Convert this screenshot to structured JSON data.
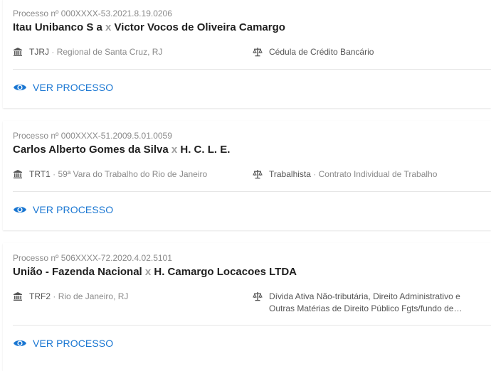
{
  "results": [
    {
      "process_prefix": "Processo nº",
      "process_number": "000XXXX-53.2021.8.19.0206",
      "party_a": "Itau Unibanco S a",
      "separator": "x",
      "party_b": "Victor Vocos de Oliveira Camargo",
      "court": "TJRJ",
      "court_detail": "Regional de Santa Cruz, RJ",
      "subject_main": "Cédula de Crédito Bancário",
      "subject_detail": "",
      "action_label": "VER PROCESSO",
      "court_icon": "bank-icon",
      "subject_icon": "scales-icon",
      "action_icon": "eye-icon"
    },
    {
      "process_prefix": "Processo nº",
      "process_number": "000XXXX-51.2009.5.01.0059",
      "party_a": "Carlos Alberto Gomes da Silva",
      "separator": "x",
      "party_b": "H. C. L. E.",
      "court": "TRT1",
      "court_detail": "59ª Vara do Trabalho do Rio de Janeiro",
      "subject_main": "Trabalhista",
      "subject_detail": "Contrato Individual de Trabalho",
      "action_label": "VER PROCESSO",
      "court_icon": "bank-icon",
      "subject_icon": "scales-icon",
      "action_icon": "eye-icon"
    },
    {
      "process_prefix": "Processo nº",
      "process_number": "506XXXX-72.2020.4.02.5101",
      "party_a": "União - Fazenda Nacional",
      "separator": "x",
      "party_b": "H. Camargo Locacoes LTDA",
      "court": "TRF2",
      "court_detail": "Rio de Janeiro, RJ",
      "subject_main": "Dívida Ativa Não-tributária, Direito Administrativo e Outras Matérias de Direito Público Fgts/fundo de Garantia Por Tempo de Serviço",
      "subject_detail": "",
      "action_label": "VER PROCESSO",
      "court_icon": "bank-icon",
      "subject_icon": "scales-icon",
      "action_icon": "eye-icon"
    }
  ],
  "colors": {
    "accent": "#1976d2",
    "muted": "#8a8a8a",
    "title": "#1f1f1f",
    "divider": "#e6e6e6"
  }
}
